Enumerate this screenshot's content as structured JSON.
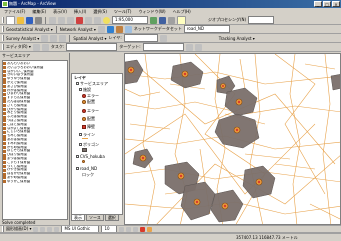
{
  "window": {
    "title": "無題 - ArcMap - ArcView",
    "buttons": [
      "_",
      "□",
      "×"
    ]
  },
  "menubar": {
    "items": [
      "ファイル(F)",
      "編集(E)",
      "表示(V)",
      "挿入(I)",
      "選択(S)",
      "ツール(T)",
      "ウィンドウ(W)",
      "ヘルプ(H)"
    ]
  },
  "toolbar1": {
    "editor_label": "Editor ▾",
    "scale_value": "1:95,000",
    "layer_label": "ジオプロセシング(N)"
  },
  "toolbar2": {
    "geostat_label": "Geostatistical Analyst ▾",
    "network_label": "Network Analyst ▾",
    "network_layer": "ネットワークデータセット",
    "network_value": "road_ND"
  },
  "toolbar3": {
    "survey_label": "Survey Analyst ▾",
    "spatial_label": "Spatial Analyst ▾",
    "layer_label": "レイヤ:",
    "tracking_label": "Tracking Analyst ▾"
  },
  "toolbar4": {
    "editor_label": "エディタ(R) ▾",
    "task_label": "タスク:",
    "target_label": "ターゲット:"
  },
  "left_panel": {
    "title": "サービスエリア",
    "items": [
      "おんもりおおい",
      "たいぶうろおおい保育園",
      "なかいいこ保育園",
      "きのいぼう保育園",
      "ゆうゆう保育園",
      "かえで保育園",
      "あさひ保育園",
      "わかば保育園",
      "ひまわり保育園",
      "すずらん保育園",
      "たんぽぽ保育園",
      "さくら保育園",
      "ひかり保育園",
      "みどり保育園",
      "ふたば保育園",
      "つばさ保育園",
      "こばと保育園",
      "なかよし保育園",
      "にじいろ保育園",
      "もみじ保育園",
      "あおば保育園",
      "すみれ保育園",
      "かもめ保育園",
      "ほしぞら保育園",
      "ひばり保育園",
      "まつば保育園",
      "こすもす保育園",
      "つくし保育園",
      "けやき保育園",
      "はるかぜ保育園",
      "あやめ保育園",
      "ゆりかご保育園"
    ],
    "status": "Solve completed"
  },
  "toc": {
    "root": "レイヤ",
    "rows": [
      "サービスエリア",
      "施設",
      "エラー",
      "配置",
      "エラー",
      "配置",
      "障壁",
      "ライン",
      "ポリゴン",
      "CVS_hokuba",
      "road_ND",
      "ロック"
    ],
    "tabs": [
      "表示",
      "ソース",
      "選択"
    ]
  },
  "drawing_toolbar": {
    "draw_label": "図形描画(D) ▾",
    "font_label": "MS UI Gothic",
    "size_label": "10"
  },
  "status": {
    "coords": "357407.13  116847.73 メートル"
  },
  "colors": {
    "polygon_fill": "#7a6f6a",
    "road_line": "#e8a24a",
    "facility_red": "#d93a2b",
    "title_blue": "#0a246a"
  }
}
